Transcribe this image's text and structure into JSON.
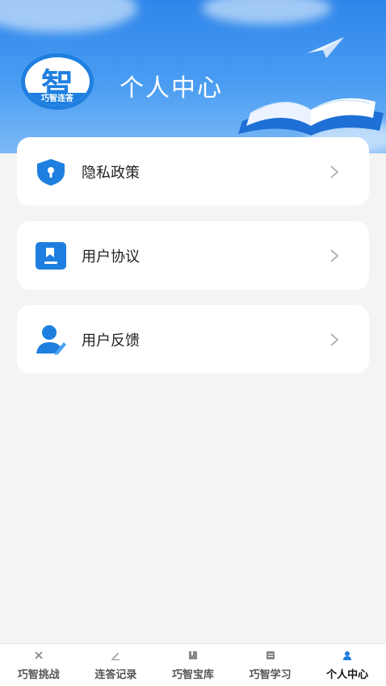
{
  "header": {
    "title": "个人中心",
    "logo_char": "智",
    "logo_band": "巧智连答"
  },
  "menu": [
    {
      "label": "隐私政策",
      "icon": "shield-icon"
    },
    {
      "label": "用户协议",
      "icon": "document-icon"
    },
    {
      "label": "用户反馈",
      "icon": "user-edit-icon"
    }
  ],
  "tabs": [
    {
      "label": "巧智挑战",
      "icon": "challenge-icon",
      "active": false
    },
    {
      "label": "连答记录",
      "icon": "pen-icon",
      "active": false
    },
    {
      "label": "巧智宝库",
      "icon": "library-icon",
      "active": false
    },
    {
      "label": "巧智学习",
      "icon": "study-icon",
      "active": false
    },
    {
      "label": "个人中心",
      "icon": "profile-icon",
      "active": true
    }
  ],
  "colors": {
    "accent": "#1e7fe0",
    "header_top": "#2f86ea",
    "background": "#f4f4f4"
  }
}
